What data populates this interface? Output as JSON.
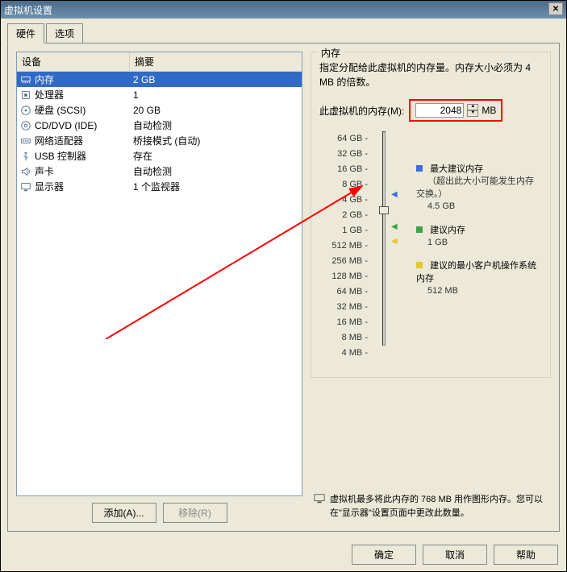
{
  "window": {
    "title": "虚拟机设置"
  },
  "tabs": [
    {
      "label": "硬件",
      "active": true
    },
    {
      "label": "选项",
      "active": false
    }
  ],
  "table": {
    "headers": [
      "设备",
      "摘要"
    ],
    "rows": [
      {
        "icon": "memory",
        "name": "内存",
        "summary": "2 GB",
        "selected": true
      },
      {
        "icon": "cpu",
        "name": "处理器",
        "summary": "1"
      },
      {
        "icon": "disk",
        "name": "硬盘 (SCSI)",
        "summary": "20 GB"
      },
      {
        "icon": "cd",
        "name": "CD/DVD (IDE)",
        "summary": "自动检测"
      },
      {
        "icon": "net",
        "name": "网络适配器",
        "summary": "桥接模式 (自动)"
      },
      {
        "icon": "usb",
        "name": "USB 控制器",
        "summary": "存在"
      },
      {
        "icon": "sound",
        "name": "声卡",
        "summary": "自动检测"
      },
      {
        "icon": "display",
        "name": "显示器",
        "summary": "1 个监视器"
      }
    ]
  },
  "left_buttons": {
    "add": "添加(A)...",
    "remove": "移除(R)"
  },
  "memory": {
    "group_title": "内存",
    "description": "指定分配给此虚拟机的内存量。内存大小必须为 4 MB 的倍数。",
    "label": "此虚拟机的内存(M):",
    "value": "2048",
    "unit": "MB",
    "ticks": [
      "64 GB",
      "32 GB",
      "16 GB",
      "8 GB",
      "4 GB",
      "2 GB",
      "1 GB",
      "512 MB",
      "256 MB",
      "128 MB",
      "64 MB",
      "32 MB",
      "16 MB",
      "8 MB",
      "4 MB"
    ],
    "legend": {
      "max": {
        "label": "最大建议内存",
        "sub": "（超出此大小可能发生内存交换。）",
        "value": "4.5 GB",
        "color": "#3b6fd4"
      },
      "rec": {
        "label": "建议内存",
        "value": "1 GB",
        "color": "#3fa24a"
      },
      "min": {
        "label": "建议的最小客户机操作系统内存",
        "value": "512 MB",
        "color": "#e6c72e"
      }
    },
    "footnote_icon": "display",
    "footnote": "虚拟机最多将此内存的 768 MB 用作图形内存。您可以在\"显示器\"设置页面中更改此数量。"
  },
  "footer": {
    "ok": "确定",
    "cancel": "取消",
    "help": "帮助"
  }
}
